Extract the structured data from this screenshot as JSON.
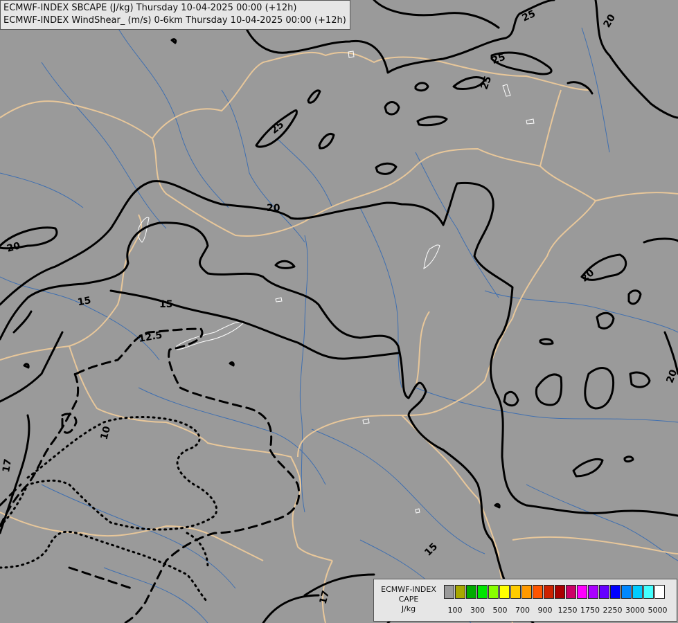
{
  "header": {
    "line1": "ECMWF-INDEX SBCAPE (J/kg) Thursday 10-04-2025 00:00 (+12h)",
    "line2": "ECMWF-INDEX WindShear_ (m/s) 0-6km Thursday 10-04-2025 00:00 (+12h)"
  },
  "legend": {
    "line1": "ECMWF-INDEX",
    "line2": "CAPE",
    "line3": "J/kg",
    "colors": [
      "#9a9a9a",
      "#a8a800",
      "#00aa00",
      "#00e600",
      "#88ff00",
      "#ffff00",
      "#ffcc00",
      "#ff9900",
      "#ff5500",
      "#cc2200",
      "#aa0000",
      "#cc0066",
      "#ff00ff",
      "#aa00ff",
      "#6600ff",
      "#0000ff",
      "#0088ff",
      "#00ccff",
      "#44ffff",
      "#ffffff"
    ],
    "ticks": [
      "100",
      "300",
      "500",
      "700",
      "900",
      "1250",
      "1750",
      "2250",
      "3000",
      "5000"
    ]
  },
  "contour_labels": [
    {
      "id": "l25a",
      "text": "25"
    },
    {
      "id": "l25b",
      "text": "25"
    },
    {
      "id": "l25c",
      "text": "25"
    },
    {
      "id": "l25d",
      "text": "25"
    },
    {
      "id": "l20a",
      "text": "20"
    },
    {
      "id": "l20b",
      "text": "20"
    },
    {
      "id": "l20c",
      "text": "20"
    },
    {
      "id": "l20d",
      "text": "20"
    },
    {
      "id": "l20e",
      "text": "20"
    },
    {
      "id": "l15a",
      "text": "15"
    },
    {
      "id": "l15b",
      "text": "15"
    },
    {
      "id": "l15c",
      "text": "15"
    },
    {
      "id": "l125",
      "text": "12.5"
    },
    {
      "id": "l10",
      "text": "10"
    },
    {
      "id": "l17a",
      "text": "17"
    },
    {
      "id": "l17b",
      "text": "17"
    }
  ]
}
